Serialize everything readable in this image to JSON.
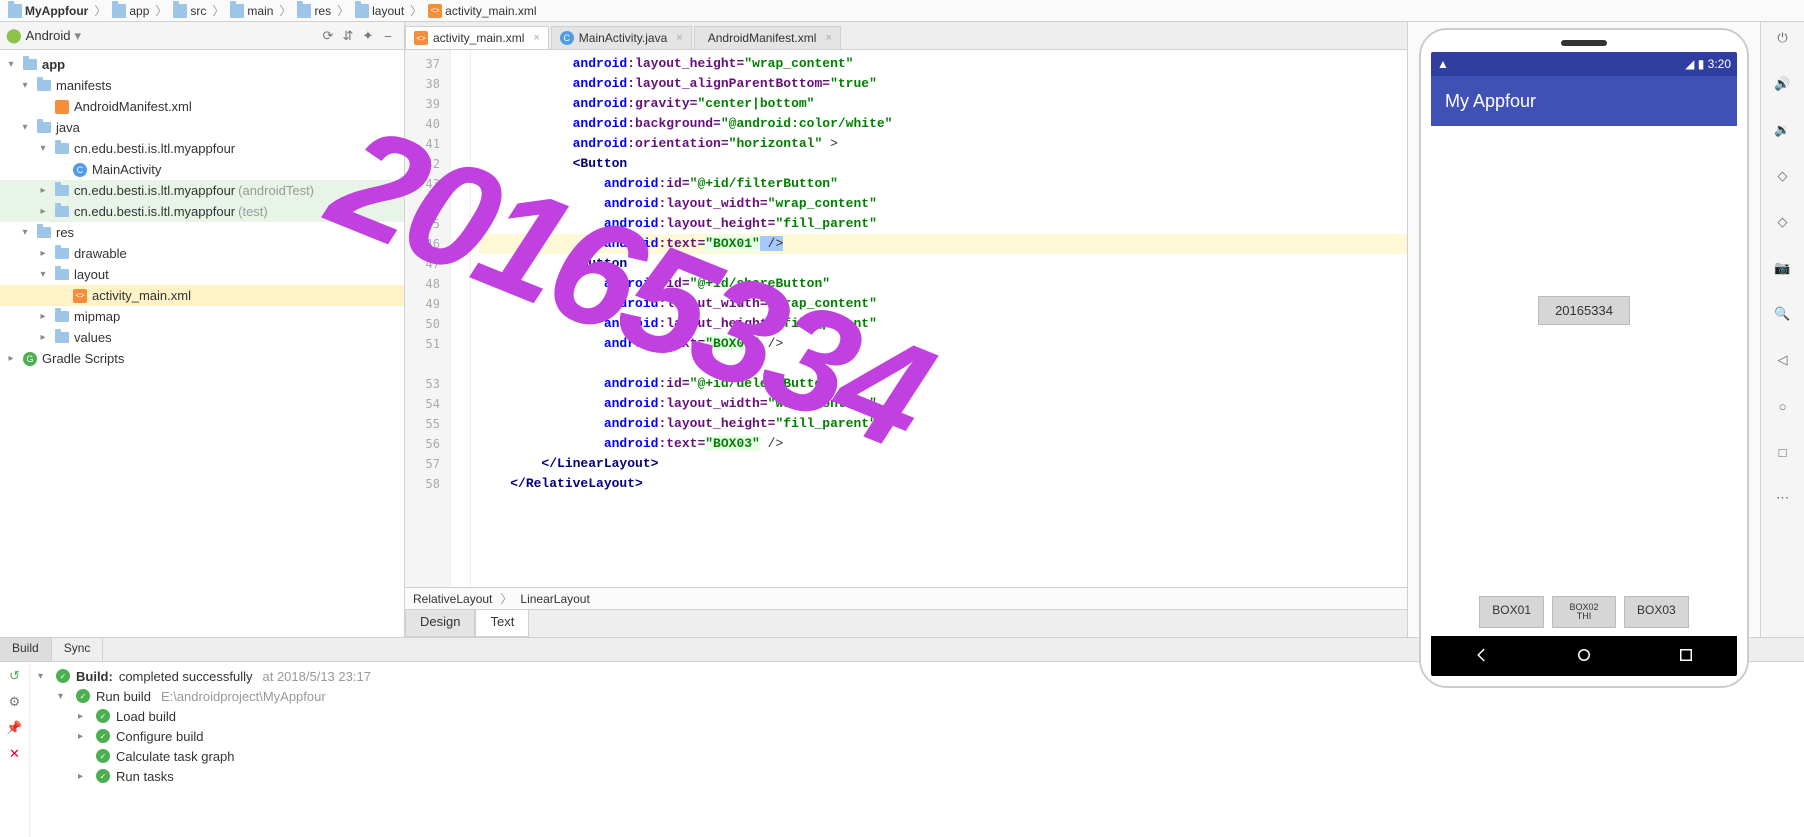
{
  "breadcrumbs": [
    "MyAppfour",
    "app",
    "src",
    "main",
    "res",
    "layout",
    "activity_main.xml"
  ],
  "left": {
    "module_selector": "Android",
    "tree": [
      {
        "ind": 0,
        "tw": "▾",
        "icon": "folder",
        "label": "app",
        "bold": true
      },
      {
        "ind": 1,
        "tw": "▾",
        "icon": "folder",
        "label": "manifests"
      },
      {
        "ind": 2,
        "tw": "",
        "icon": "manifest",
        "label": "AndroidManifest.xml"
      },
      {
        "ind": 1,
        "tw": "▾",
        "icon": "folder",
        "label": "java"
      },
      {
        "ind": 2,
        "tw": "▾",
        "icon": "folder",
        "label": "cn.edu.besti.is.ltl.myappfour"
      },
      {
        "ind": 3,
        "tw": "",
        "icon": "java",
        "label": "MainActivity"
      },
      {
        "ind": 2,
        "tw": "▸",
        "icon": "folder",
        "label": "cn.edu.besti.is.ltl.myappfour",
        "dim": "(androidTest)",
        "hl": true
      },
      {
        "ind": 2,
        "tw": "▸",
        "icon": "folder",
        "label": "cn.edu.besti.is.ltl.myappfour",
        "dim": "(test)",
        "hl": true
      },
      {
        "ind": 1,
        "tw": "▾",
        "icon": "folder",
        "label": "res"
      },
      {
        "ind": 2,
        "tw": "▸",
        "icon": "folder",
        "label": "drawable"
      },
      {
        "ind": 2,
        "tw": "▾",
        "icon": "folder",
        "label": "layout"
      },
      {
        "ind": 3,
        "tw": "",
        "icon": "xml",
        "label": "activity_main.xml",
        "sel": true
      },
      {
        "ind": 2,
        "tw": "▸",
        "icon": "folder",
        "label": "mipmap"
      },
      {
        "ind": 2,
        "tw": "▸",
        "icon": "folder",
        "label": "values"
      },
      {
        "ind": 0,
        "tw": "▸",
        "icon": "gradle",
        "label": "Gradle Scripts"
      }
    ]
  },
  "tabs": [
    {
      "icon": "xml",
      "label": "activity_main.xml",
      "active": true
    },
    {
      "icon": "java",
      "label": "MainActivity.java"
    },
    {
      "icon": "manifest",
      "label": "AndroidManifest.xml"
    }
  ],
  "gutter": [
    "37",
    "38",
    "39",
    "40",
    "41",
    "42",
    "43",
    "44",
    "45",
    "46",
    "47",
    "48",
    "49",
    "50",
    "51",
    "",
    "53",
    "54",
    "55",
    "56",
    "57",
    "58"
  ],
  "code": {
    "l37": {
      "i": 12,
      "a": "layout_height",
      "v": "wrap_content"
    },
    "l38": {
      "i": 12,
      "a": "layout_alignParentBottom",
      "v": "true"
    },
    "l39": {
      "i": 12,
      "a": "gravity",
      "v": "center|bottom"
    },
    "l40": {
      "i": 12,
      "a": "background",
      "v": "@android:color/white"
    },
    "l41": {
      "i": 12,
      "a": "orientation",
      "v": "horizontal",
      "close": " >"
    },
    "l42": {
      "i": 12,
      "tag": "<Button"
    },
    "l43": {
      "i": 16,
      "a": "id",
      "v": "@+id/filterButton"
    },
    "l44": {
      "i": 16,
      "a": "layout_width",
      "v": "wrap_content"
    },
    "l45": {
      "i": 16,
      "a": "layout_height",
      "v": "fill_parent"
    },
    "l46": {
      "i": 16,
      "a": "text",
      "v": "BOX01",
      "close": " />",
      "hl": true,
      "selclose": true
    },
    "l47": {
      "i": 12,
      "tag": "<Button"
    },
    "l48": {
      "i": 16,
      "a": "id",
      "v": "@+id/shareButton"
    },
    "l49": {
      "i": 16,
      "a": "layout_width",
      "v": "wrap_content"
    },
    "l50": {
      "i": 16,
      "a": "layout_height",
      "v": "fill_parent"
    },
    "l51": {
      "i": 16,
      "a": "text",
      "v": "BOX02",
      "close": " />",
      "hl": true
    },
    "l52": {
      "i": 12,
      "raw": ""
    },
    "l53": {
      "i": 16,
      "a": "id",
      "v": "@+id/deleteButton"
    },
    "l54": {
      "i": 16,
      "a": "layout_width",
      "v": "wrap_content",
      "ob": true
    },
    "l55": {
      "i": 16,
      "a": "layout_height",
      "v": "fill_parent",
      "ob": true
    },
    "l56": {
      "i": 16,
      "a": "text",
      "v": "BOX03",
      "close": " />",
      "hl": true,
      "ob": true
    },
    "l57": {
      "i": 8,
      "tagc": "</LinearLayout>",
      "ob": true
    },
    "l58": {
      "i": 4,
      "tagc": "</RelativeLayout>",
      "ob": true
    }
  },
  "bread2": [
    "RelativeLayout",
    "LinearLayout"
  ],
  "modetabs": {
    "design": "Design",
    "text": "Text"
  },
  "emu": {
    "time": "3:20",
    "app_title": "My Appfour",
    "center_btn": "20165334",
    "btn1": "BOX01",
    "btn2_a": "BOX02",
    "btn2_b": "THI",
    "btn3": "BOX03"
  },
  "build": {
    "tabs": {
      "build": "Build",
      "sync": "Sync"
    },
    "title": "Build:",
    "status": "completed successfully",
    "ts": "at 2018/5/13 23:17",
    "rows": [
      {
        "i": 1,
        "tw": "▾",
        "label": "Run build",
        "dim": "E:\\androidproject\\MyAppfour"
      },
      {
        "i": 2,
        "tw": "▸",
        "label": "Load build"
      },
      {
        "i": 2,
        "tw": "▸",
        "label": "Configure build"
      },
      {
        "i": 2,
        "tw": "",
        "label": "Calculate task graph"
      },
      {
        "i": 2,
        "tw": "▸",
        "label": "Run tasks"
      }
    ]
  },
  "watermark": "20165334"
}
